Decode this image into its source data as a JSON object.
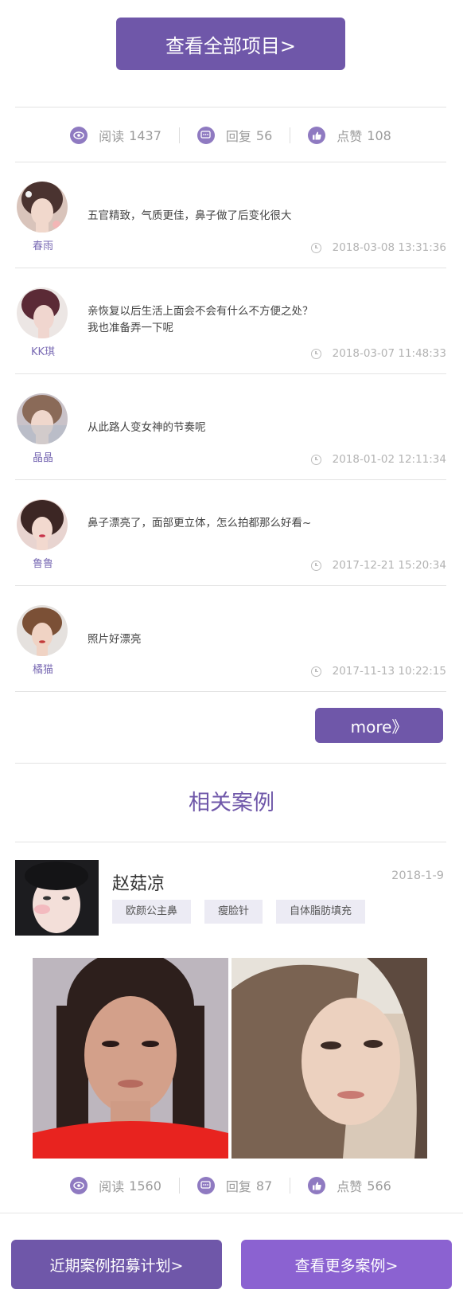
{
  "view_all_button": "查看全部项目>",
  "stats_top": {
    "read_label": "阅读",
    "read_count": "1437",
    "reply_label": "回复",
    "reply_count": "56",
    "like_label": "点赞",
    "like_count": "108"
  },
  "comments": [
    {
      "name": "春雨",
      "text": "五官精致，气质更佳，鼻子做了后变化很大",
      "time": "2018-03-08 13:31:36"
    },
    {
      "name": "KK琪",
      "text": "亲恢复以后生活上面会不会有什么不方便之处？我也准备弄一下呢",
      "time": "2018-03-07 11:48:33"
    },
    {
      "name": "晶晶",
      "text": "从此路人变女神的节奏呢",
      "time": "2018-01-02 12:11:34"
    },
    {
      "name": "鲁鲁",
      "text": "鼻子漂亮了，面部更立体，怎么拍都那么好看~",
      "time": "2017-12-21 15:20:34"
    },
    {
      "name": "橘猫",
      "text": "照片好漂亮",
      "time": "2017-11-13 10:22:15"
    }
  ],
  "more_button": "more》",
  "related_title": "相关案例",
  "case": {
    "name": "赵菇凉",
    "date": "2018-1-9",
    "tags": [
      "欧颜公主鼻",
      "瘦脸针",
      "自体脂肪填充"
    ]
  },
  "stats_bottom": {
    "read_label": "阅读",
    "read_count": "1560",
    "reply_label": "回复",
    "reply_count": "87",
    "like_label": "点赞",
    "like_count": "566"
  },
  "bottom_buttons": {
    "left": "近期案例招募计划>",
    "right": "查看更多案例>"
  },
  "colors": {
    "primary": "#6f57a9",
    "primary_light": "#8b62d1",
    "icon": "#8f7ac1"
  },
  "icons": [
    "eye-icon",
    "message-icon",
    "thumbs-up-icon",
    "clock-icon"
  ]
}
